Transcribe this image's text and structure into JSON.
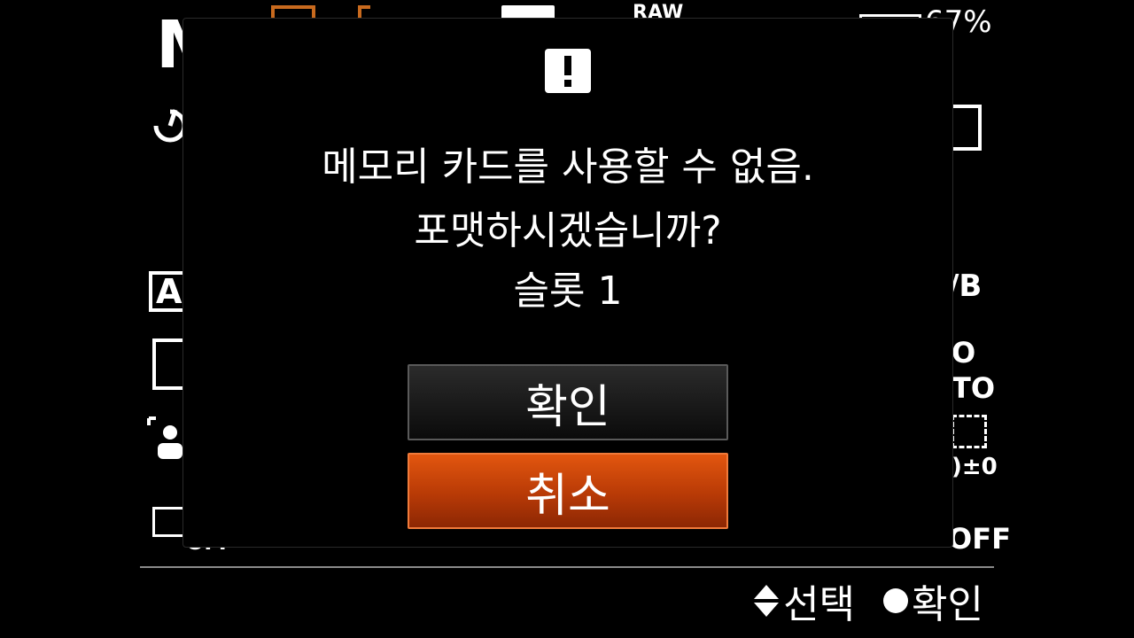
{
  "background_overlay": {
    "battery_percent": "67%",
    "top_badge": "RAW",
    "mode_letter": "M",
    "af_label": "AF",
    "white_balance": "/B",
    "iso_label": "O",
    "iso_auto": "TO",
    "ev_value": ")±0",
    "off_left": "OFF",
    "off_right": "OFF"
  },
  "dialog": {
    "message_line1": "메모리 카드를 사용할 수 없음.",
    "message_line2": "포맷하시겠습니까?",
    "message_line3": "슬롯 1",
    "confirm_label": "확인",
    "cancel_label": "취소",
    "selected_button": "cancel",
    "accent_color": "#d9480f"
  },
  "footer": {
    "select_hint": "선택",
    "confirm_hint": "확인"
  }
}
